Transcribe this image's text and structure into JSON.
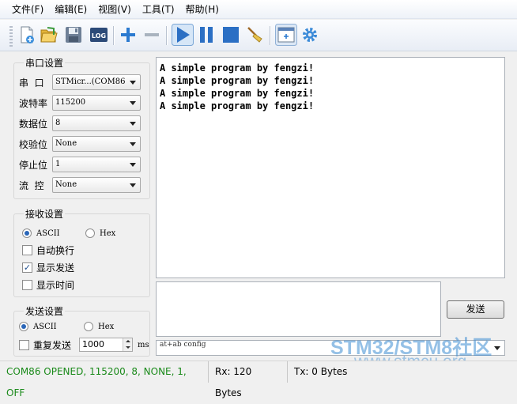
{
  "menu": [
    {
      "label": "文件(F)"
    },
    {
      "label": "编辑(E)"
    },
    {
      "label": "视图(V)"
    },
    {
      "label": "工具(T)"
    },
    {
      "label": "帮助(H)"
    }
  ],
  "toolbar": {
    "log_label": "LOG"
  },
  "serial_settings": {
    "title": "串口设置",
    "port": {
      "label": "串  口",
      "value": "STMicr...(COM86"
    },
    "baud": {
      "label": "波特率",
      "value": "115200"
    },
    "data_bits": {
      "label": "数据位",
      "value": "8"
    },
    "parity": {
      "label": "校验位",
      "value": "None"
    },
    "stop_bits": {
      "label": "停止位",
      "value": "1"
    },
    "flow": {
      "label": "流  控",
      "value": "None"
    }
  },
  "receive_settings": {
    "title": "接收设置",
    "ascii_label": "ASCII",
    "hex_label": "Hex",
    "auto_newline": "自动换行",
    "show_send": "显示发送",
    "show_time": "显示时间"
  },
  "send_settings": {
    "title": "发送设置",
    "ascii_label": "ASCII",
    "hex_label": "Hex",
    "repeat_label": "重复发送",
    "interval": "1000",
    "unit": "ms"
  },
  "receive_text": [
    "A simple program by fengzi!",
    "A simple program by fengzi!",
    "A simple program by fengzi!",
    "A simple program by fengzi!"
  ],
  "send_button": "发送",
  "command_combo": "at+ab config",
  "status": {
    "connection": "COM86 OPENED, 115200, 8, NONE, 1, OFF",
    "rx": "Rx: 120 Bytes",
    "tx": "Tx: 0 Bytes"
  },
  "watermark": {
    "line1": "STM32/STM8社区",
    "line2": "www.stmcu.org"
  },
  "colors": {
    "status_green": "#1a8a1a",
    "accent_blue": "#2a66b8"
  }
}
